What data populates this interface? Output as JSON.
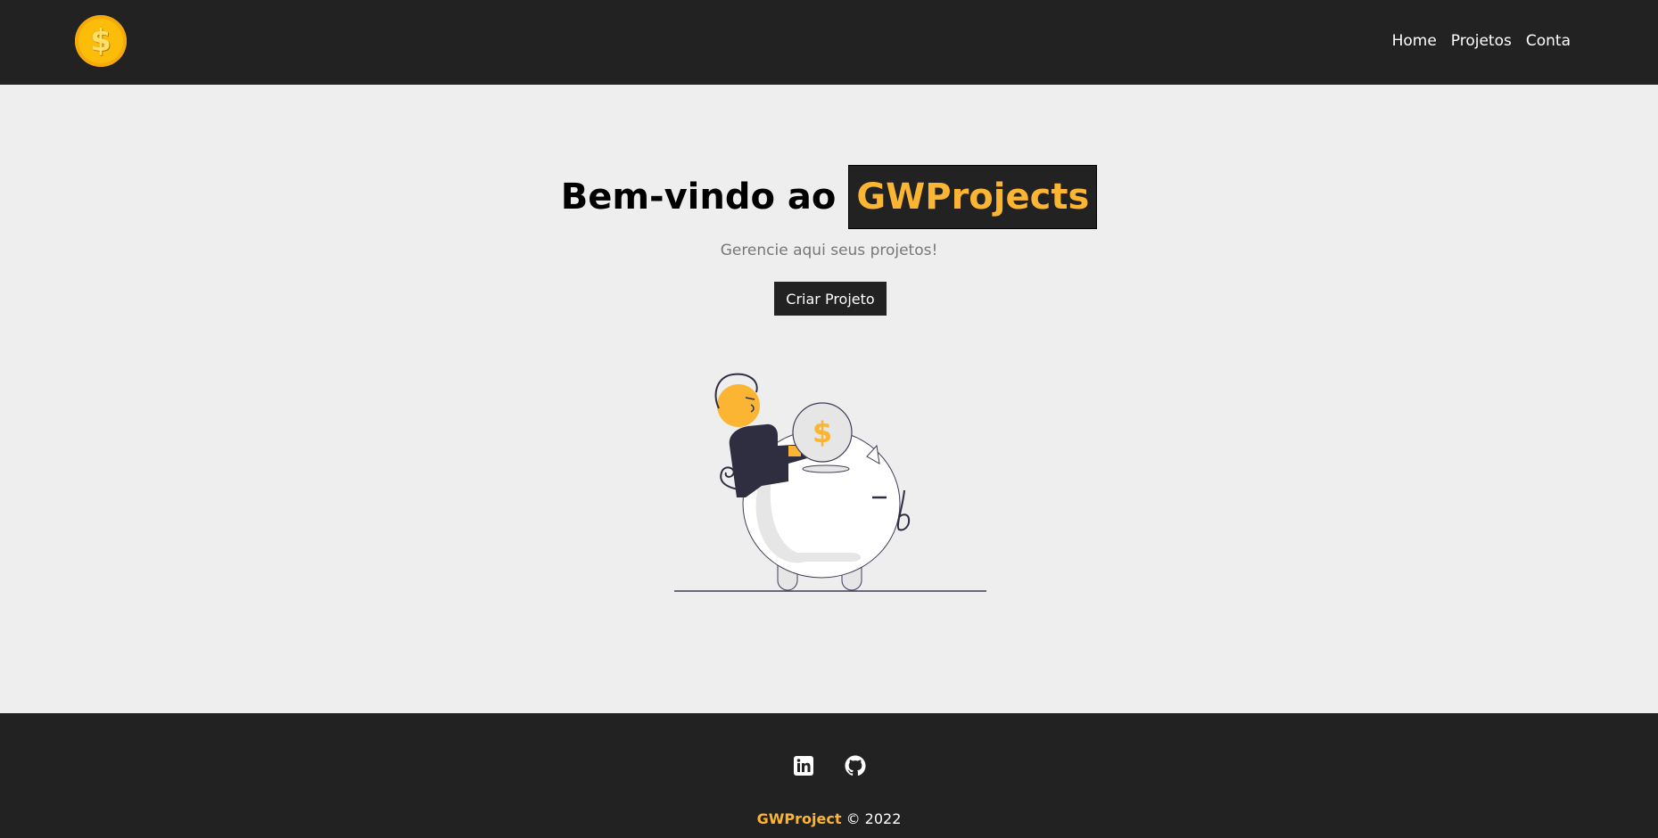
{
  "navbar": {
    "logo_icon": "dollar-coin-icon",
    "logo_symbol": "$",
    "links": [
      "Home",
      "Projetos",
      "Conta"
    ]
  },
  "hero": {
    "title_prefix": "Bem-vindo ao",
    "title_brand": "GWProjects",
    "subtitle": "Gerencie aqui seus projetos!",
    "cta_label": "Criar Projeto",
    "illustration": "piggy-bank-illustration",
    "coin_symbol": "$"
  },
  "footer": {
    "social_icons": [
      "linkedin-icon",
      "github-icon"
    ],
    "brand": "GWProject",
    "copyright": "© 2022"
  },
  "colors": {
    "dark": "#222222",
    "accent": "#fbb533",
    "background": "#eeeeee",
    "muted": "#777777"
  }
}
